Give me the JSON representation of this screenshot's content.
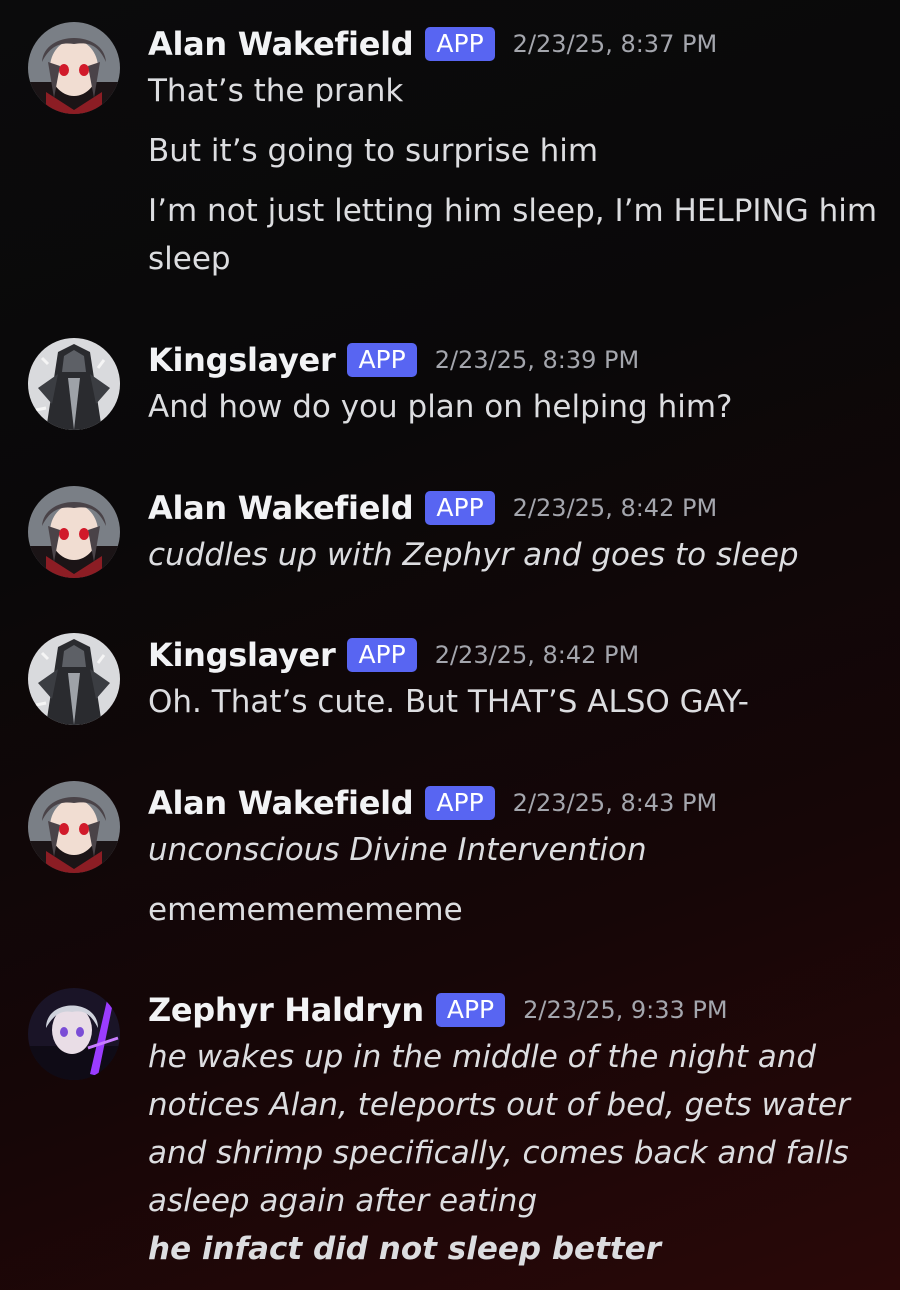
{
  "messages": [
    {
      "author": "Alan Wakefield",
      "badge": "APP",
      "timestamp": "2/23/25, 8:37 PM",
      "avatar_icon": "anime-avatar-white-hair-red-eyes",
      "lines": [
        "That’s the prank",
        "But it’s going to surprise him",
        "I’m not just letting him sleep, I’m HELPING him",
        "sleep"
      ]
    },
    {
      "author": "Kingslayer",
      "badge": "APP",
      "timestamp": "2/23/25, 8:39 PM",
      "avatar_icon": "armored-knight-avatar",
      "lines": [
        "And how do you plan on helping him?"
      ]
    },
    {
      "author": "Alan Wakefield",
      "badge": "APP",
      "timestamp": "2/23/25, 8:42 PM",
      "avatar_icon": "anime-avatar-white-hair-red-eyes",
      "lines": [
        "cuddles up with Zephyr and goes to sleep"
      ]
    },
    {
      "author": "Kingslayer",
      "badge": "APP",
      "timestamp": "2/23/25, 8:42 PM",
      "avatar_icon": "armored-knight-avatar",
      "lines": [
        "Oh. That’s cute. But THAT’S ALSO GAY-"
      ]
    },
    {
      "author": "Alan Wakefield",
      "badge": "APP",
      "timestamp": "2/23/25, 8:43 PM",
      "avatar_icon": "anime-avatar-white-hair-red-eyes",
      "lines": [
        "unconscious Divine Intervention",
        "ememememememe"
      ]
    },
    {
      "author": "Zephyr Haldryn",
      "badge": "APP",
      "timestamp": "2/23/25, 9:33 PM",
      "avatar_icon": "anime-avatar-purple-sword",
      "lines": [
        "he wakes up in the middle of the night and",
        "notices Alan, teleports out of bed, gets water",
        "and shrimp specifically, comes back and falls",
        "asleep again after eating",
        "he infact did not sleep better"
      ]
    }
  ],
  "colors": {
    "badge": "#5865f2",
    "timestamp": "#a4a6ad",
    "name": "#f2f3f5",
    "text": "#dcdde0"
  }
}
